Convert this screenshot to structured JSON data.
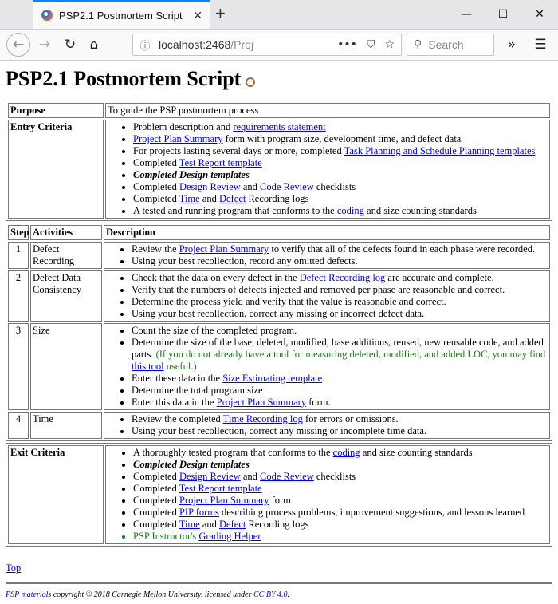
{
  "browser": {
    "tab_title": "PSP2.1 Postmortem Script",
    "url_host": "localhost:2468",
    "url_path": "/Proj",
    "search_placeholder": "Search"
  },
  "page": {
    "title": "PSP2.1 Postmortem Script",
    "purpose_label": "Purpose",
    "purpose_text": "To guide the PSP postmortem process",
    "entry_label": "Entry Criteria",
    "entry": {
      "i1a": "Problem description and ",
      "i1b": "requirements statement",
      "i2a": "Project Plan Summary",
      "i2b": " form with program size, development time, and defect data",
      "i3a": "For projects lasting several days or more, completed ",
      "i3b": "Task Planning and Schedule Planning templates",
      "i4a": "Completed ",
      "i4b": "Test Report template",
      "i5": "Completed Design templates",
      "i6a": "Completed ",
      "i6b": "Design Review",
      "i6c": " and ",
      "i6d": "Code Review",
      "i6e": " checklists",
      "i7a": "Completed ",
      "i7b": "Time",
      "i7c": " and ",
      "i7d": "Defect",
      "i7e": " Recording logs",
      "i8a": "A tested and running program that conforms to the ",
      "i8b": "coding",
      "i8c": " and size counting standards"
    },
    "headers": {
      "step": "Step",
      "activities": "Activities",
      "description": "Description"
    },
    "steps": {
      "s1": {
        "num": "1",
        "activity": "Defect Recording",
        "a": "Review the ",
        "b": "Project Plan Summary",
        "c": " to verify that all of the defects found in each phase were recorded.",
        "d": "Using your best recollection, record any omitted defects."
      },
      "s2": {
        "num": "2",
        "activity": "Defect Data Consistency",
        "a": "Check that the data on every defect in the ",
        "b": "Defect Recording log",
        "c": " are accurate and complete.",
        "d": "Verify that the numbers of defects injected and removed per phase are reasonable and correct.",
        "e": "Determine the process yield and verify that the value is reasonable and correct.",
        "f": "Using your best recollection, correct any missing or incorrect defect data."
      },
      "s3": {
        "num": "3",
        "activity": "Size",
        "a": "Count the size of the completed program.",
        "b": "Determine the size of the base, deleted, modified, base additions, reused, new reusable code, and added parts. ",
        "c": "(If you do not already have a tool for measuring deleted, modified, and added LOC, you may find ",
        "d": "this tool",
        "e": " useful.)",
        "f": "Enter these data in the ",
        "g": "Size Estimating template",
        "h": ".",
        "i": "Determine the total program size",
        "j": "Enter this data in the ",
        "k": "Project Plan Summary",
        "l": " form."
      },
      "s4": {
        "num": "4",
        "activity": "Time",
        "a": "Review the completed ",
        "b": "Time Recording log",
        "c": " for errors or omissions.",
        "d": "Using your best recollection, correct any missing or incomplete time data."
      }
    },
    "exit_label": "Exit Criteria",
    "exit": {
      "i1a": "A thoroughly tested program that conforms to the ",
      "i1b": "coding",
      "i1c": " and size counting standards",
      "i2": "Completed Design templates",
      "i3a": "Completed ",
      "i3b": "Design Review",
      "i3c": " and ",
      "i3d": "Code Review",
      "i3e": " checklists",
      "i4a": "Completed ",
      "i4b": "Test Report template",
      "i5a": "Completed ",
      "i5b": "Project Plan Summary",
      "i5c": " form",
      "i6a": "Completed ",
      "i6b": "PIP forms",
      "i6c": " describing process problems, improvement suggestions, and lessons learned",
      "i7a": "Completed ",
      "i7b": "Time",
      "i7c": " and ",
      "i7d": "Defect",
      "i7e": " Recording logs",
      "i8a": "PSP Instructor's ",
      "i8b": "Grading Helper"
    },
    "top_link": "Top",
    "footer": {
      "a": "PSP materials",
      "b": " copyright © 2018 Carnegie Mellon University, licensed under ",
      "c": "CC BY 4.0",
      "d": "."
    }
  }
}
